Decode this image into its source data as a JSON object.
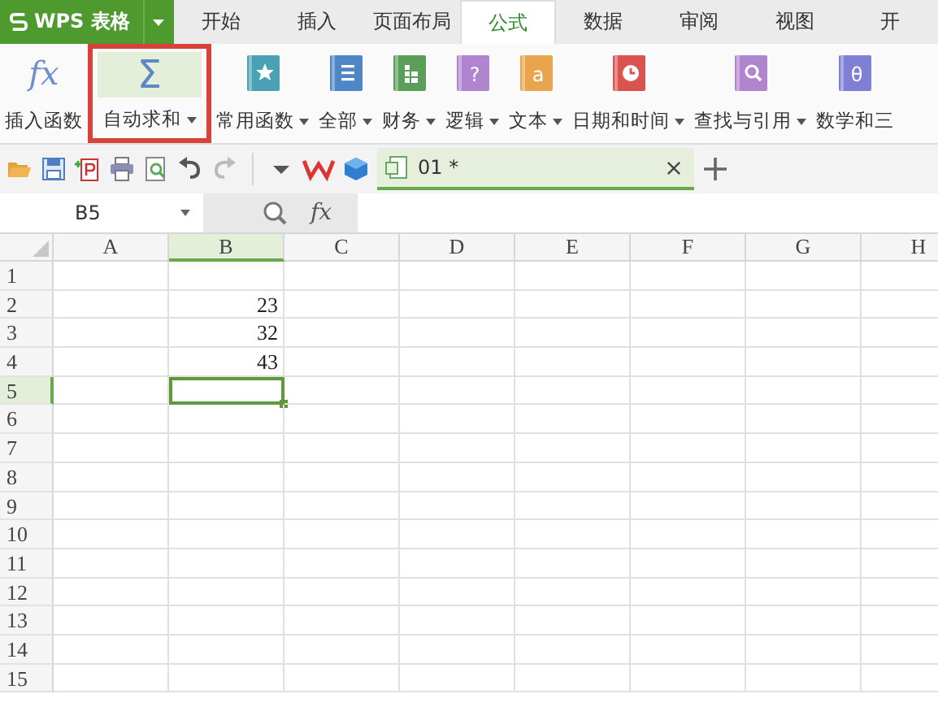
{
  "app_menu": {
    "label": "WPS 表格"
  },
  "tabs": [
    {
      "label": "开始",
      "selected": false
    },
    {
      "label": "插入",
      "selected": false
    },
    {
      "label": "页面布局",
      "selected": false
    },
    {
      "label": "公式",
      "selected": true
    },
    {
      "label": "数据",
      "selected": false
    },
    {
      "label": "审阅",
      "selected": false
    },
    {
      "label": "视图",
      "selected": false
    },
    {
      "label": "开",
      "selected": false
    }
  ],
  "ribbon": [
    {
      "kind": "fx",
      "glyph": "fx",
      "label": "插入函数",
      "dropdown": false,
      "highlighted": false
    },
    {
      "kind": "sigma",
      "glyph": "Σ",
      "label": "自动求和",
      "dropdown": true,
      "highlighted": true
    },
    {
      "kind": "star",
      "label": "常用函数",
      "dropdown": true,
      "highlighted": false,
      "color": "#4aa0b5"
    },
    {
      "kind": "list",
      "label": "全部",
      "dropdown": true,
      "highlighted": false,
      "color": "#4f86c6"
    },
    {
      "kind": "ledger",
      "label": "财务",
      "dropdown": true,
      "highlighted": false,
      "color": "#5a9e5a"
    },
    {
      "kind": "glyph",
      "glyph": "?",
      "label": "逻辑",
      "dropdown": true,
      "highlighted": false,
      "color": "#b184d0"
    },
    {
      "kind": "glyph",
      "glyph": "a",
      "label": "文本",
      "dropdown": true,
      "highlighted": false,
      "color": "#e9a54e"
    },
    {
      "kind": "clock",
      "label": "日期和时间",
      "dropdown": true,
      "highlighted": false,
      "color": "#d9534f"
    },
    {
      "kind": "search",
      "label": "查找与引用",
      "dropdown": true,
      "highlighted": false,
      "color": "#b184d0"
    },
    {
      "kind": "glyph",
      "glyph": "θ",
      "label": "数学和三",
      "dropdown": false,
      "highlighted": false,
      "color": "#7f7fd6"
    }
  ],
  "document_tab": {
    "label": "01 *"
  },
  "name_box": {
    "value": "B5"
  },
  "function_button": {
    "label": "fx"
  },
  "sheet": {
    "columns": [
      {
        "label": "A",
        "selected": false
      },
      {
        "label": "B",
        "selected": true
      },
      {
        "label": "C",
        "selected": false
      },
      {
        "label": "D",
        "selected": false
      },
      {
        "label": "E",
        "selected": false
      },
      {
        "label": "F",
        "selected": false
      },
      {
        "label": "G",
        "selected": false
      },
      {
        "label": "H",
        "selected": false
      }
    ],
    "rows": [
      {
        "label": "1",
        "selected": false
      },
      {
        "label": "2",
        "selected": false,
        "cells": {
          "B": "23"
        }
      },
      {
        "label": "3",
        "selected": false,
        "cells": {
          "B": "32"
        }
      },
      {
        "label": "4",
        "selected": false,
        "cells": {
          "B": "43"
        }
      },
      {
        "label": "5",
        "selected": true
      },
      {
        "label": "6",
        "selected": false
      },
      {
        "label": "7",
        "selected": false
      },
      {
        "label": "8",
        "selected": false
      },
      {
        "label": "9",
        "selected": false
      },
      {
        "label": "10",
        "selected": false
      },
      {
        "label": "11",
        "selected": false
      },
      {
        "label": "12",
        "selected": false
      },
      {
        "label": "13",
        "selected": false
      },
      {
        "label": "14",
        "selected": false
      },
      {
        "label": "15",
        "selected": false
      }
    ]
  }
}
